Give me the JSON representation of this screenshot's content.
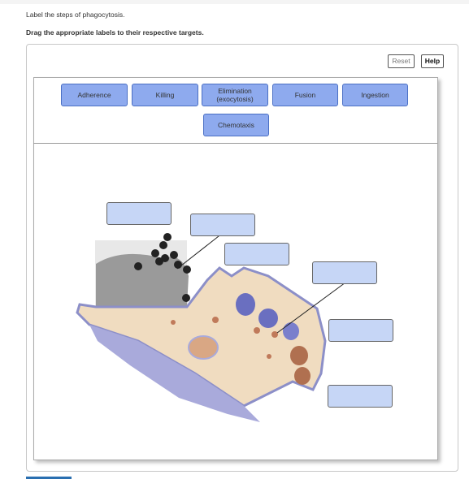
{
  "instructions": {
    "line1": "Label the steps of phagocytosis.",
    "line2": "Drag the appropriate labels to their respective targets."
  },
  "toolbar": {
    "reset": "Reset",
    "help": "Help"
  },
  "labels": [
    "Adherence",
    "Killing",
    "Elimination\n(exocytosis)",
    "Fusion",
    "Ingestion",
    "Chemotaxis"
  ],
  "targets": [
    "",
    "",
    "",
    "",
    "",
    ""
  ],
  "colors": {
    "label_fill": "#8eaaee",
    "label_border": "#4a6fc4",
    "target_fill": "#c6d6f6"
  }
}
